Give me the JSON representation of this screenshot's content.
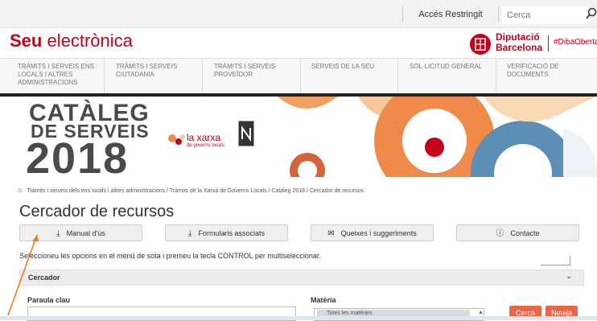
{
  "topbar": {
    "restricted_label": "Accés Restringit",
    "search_placeholder": "Cerca",
    "search_icon": "search-icon"
  },
  "header": {
    "brand_bold": "Seu",
    "brand_rest": " electrònica",
    "dipu_line1": "Diputació",
    "dipu_line2": "Barcelona",
    "hashtag": "#DibaOberta"
  },
  "nav": {
    "items": [
      "TRÀMITS I SERVEIS ENS LOCALS I ALTRES ADMINISTRACIONS",
      "TRÀMITS I SERVEIS CIUTADANIA",
      "TRÀMITS I SERVEIS PROVEÏDOR",
      "SERVEIS DE LA SEU",
      "SOL·LICITUD GENERAL",
      "VERIFICACIÓ DE DOCUMENTS"
    ]
  },
  "banner": {
    "line1": "CATÀLEG",
    "line2": "DE SERVEIS",
    "year": "2018",
    "xarxa": "la xarxa",
    "xarxa_sub": "de governs locals"
  },
  "breadcrumb": "Tràmits i serveis dels ens locals i altres administracions  /  Tràmits de la Xarxa de Governs Locals  /  Catàleg 2018  /  Cercador de recursos",
  "page": {
    "title": "Cercador de recursos",
    "buttons": [
      "Manual d'ús",
      "Formularis associats",
      "Queixes i suggeriments",
      "Contacte"
    ],
    "instructions": "Seleccioneu les opcions en el menú de sota i premeu la tecla CONTROL per multiseleccionar.",
    "panel_label": "Cercador",
    "keyword_label": "Paraula clau",
    "matter_label": "Matèria",
    "matter_option": "Totes les matèries",
    "search_button": "Cerca",
    "clear_button": "Neteja"
  },
  "colors": {
    "brand_red": "#c4001a",
    "accent_orange": "#e8674a"
  }
}
